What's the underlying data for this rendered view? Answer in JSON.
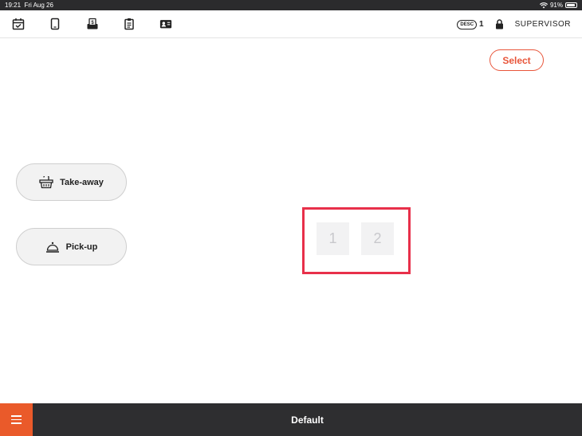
{
  "status_bar": {
    "time": "19:21",
    "date": "Fri Aug 26",
    "battery": "91%",
    "battery_level": 0.91
  },
  "toolbar": {
    "icons": [
      "calendar-check-icon",
      "tablet-icon",
      "cash-drawer-icon",
      "clipboard-icon",
      "id-card-icon"
    ],
    "desc_label": "DESC",
    "desc_count": "1",
    "user_label": "SUPERVISOR"
  },
  "select_button": {
    "label": "Select"
  },
  "order_types": [
    {
      "label": "Take-away",
      "icon": "basket-icon"
    },
    {
      "label": "Pick-up",
      "icon": "service-bell-icon"
    }
  ],
  "tables": [
    {
      "label": "1"
    },
    {
      "label": "2"
    }
  ],
  "bottom_bar": {
    "title": "Default"
  },
  "colors": {
    "accent": "#ea5a2a",
    "highlight": "#e8304a",
    "bar_dark": "#2e2e30"
  }
}
